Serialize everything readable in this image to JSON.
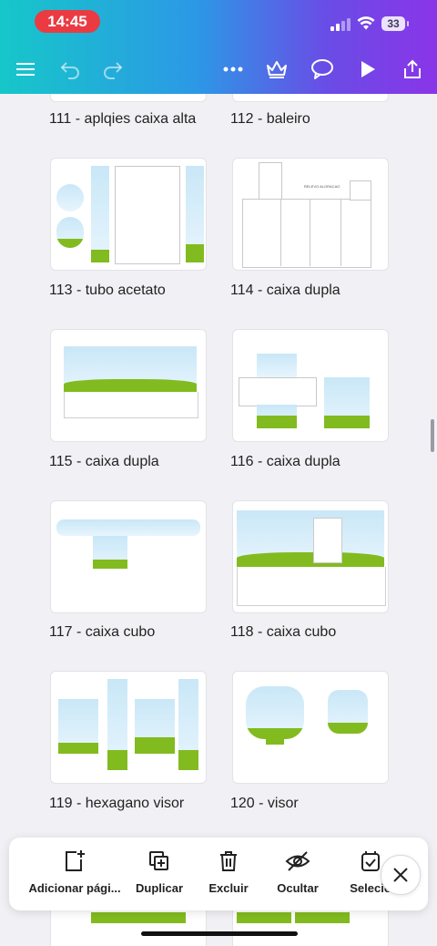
{
  "status": {
    "time": "14:45",
    "battery": "33"
  },
  "toolbar": {
    "icons": [
      "menu-icon",
      "undo-icon",
      "redo-icon",
      "more-icon",
      "crown-icon",
      "comment-icon",
      "play-icon",
      "share-icon"
    ]
  },
  "pages": [
    {
      "label": "111 - aplqies caixa alta"
    },
    {
      "label": "112 - baleiro"
    },
    {
      "label": "113 - tubo acetato"
    },
    {
      "label": "114 - caixa dupla"
    },
    {
      "label": "115 - caixa dupla"
    },
    {
      "label": "116 - caixa dupla"
    },
    {
      "label": "117 - caixa cubo"
    },
    {
      "label": "118 - caixa cubo"
    },
    {
      "label": "119 - hexagano visor"
    },
    {
      "label": "120 - visor"
    }
  ],
  "thumb_text": {
    "relief": "RELEVO ALGRACAO"
  },
  "actions": [
    {
      "label": "Adicionar pági...",
      "icon": "add-page-icon"
    },
    {
      "label": "Duplicar",
      "icon": "duplicate-icon"
    },
    {
      "label": "Excluir",
      "icon": "trash-icon"
    },
    {
      "label": "Ocultar",
      "icon": "hide-icon"
    },
    {
      "label": "Selecio",
      "icon": "select-icon"
    }
  ],
  "colors": {
    "accent_red": "#ea3b43",
    "grass": "#82bb1f",
    "sky": "#c9e7f7"
  }
}
